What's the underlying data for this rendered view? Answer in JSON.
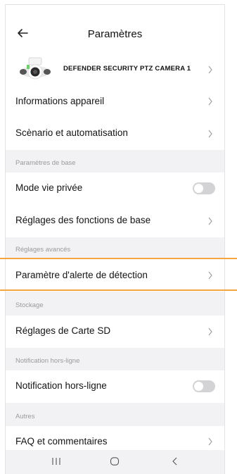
{
  "header": {
    "title": "Paramètres"
  },
  "device": {
    "name": "DEFENDER SECURITY PTZ CAMERA 1"
  },
  "items": {
    "device_info": "Informations appareil",
    "scenario": "Scènario et automatisation",
    "privacy": "Mode vie privée",
    "basic_functions": "Réglages des fonctions de base",
    "detection_alert": "Paramètre d'alerte de détection",
    "sd_card": "Réglages de Carte SD",
    "offline_notif": "Notification hors-ligne",
    "faq": "FAQ et commentaires"
  },
  "sections": {
    "basic": "Paramètres de base",
    "advanced": "Réglages avancés",
    "storage": "Stockage",
    "offline": "Notification hors-ligne",
    "others": "Autres"
  },
  "toggles": {
    "privacy_on": false,
    "offline_notif_on": false
  },
  "colors": {
    "highlight": "#f5a640",
    "toggle_off": "#d3d3d6",
    "background": "#f2f2f4"
  },
  "icons": {
    "back": "arrow-left-icon",
    "chevron": "chevron-right-icon",
    "nav_recent": "recent-apps-icon",
    "nav_home": "home-icon",
    "nav_back": "back-icon"
  }
}
